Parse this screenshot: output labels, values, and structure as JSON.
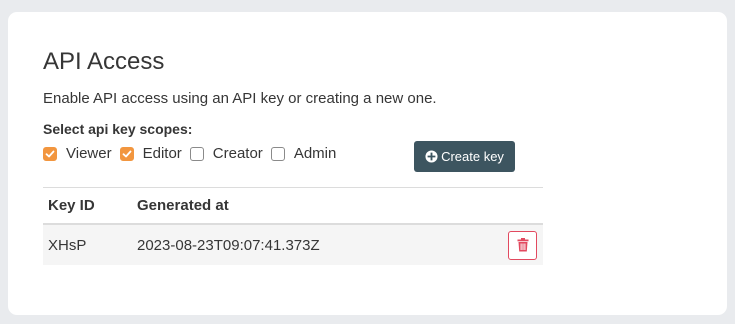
{
  "card": {
    "title": "API Access",
    "description": "Enable API access using an API key or creating a new one.",
    "scopes_label": "Select api key scopes:"
  },
  "scopes": [
    {
      "label": "Viewer",
      "checked": true
    },
    {
      "label": "Editor",
      "checked": true
    },
    {
      "label": "Creator",
      "checked": false
    },
    {
      "label": "Admin",
      "checked": false
    }
  ],
  "create_button": {
    "label": "Create key",
    "icon": "plus-circle-icon"
  },
  "table": {
    "headers": {
      "key_id": "Key ID",
      "generated_at": "Generated at"
    },
    "rows": [
      {
        "key_id": "XHsP",
        "generated_at": "2023-08-23T09:07:41.373Z"
      }
    ]
  },
  "colors": {
    "checkbox_checked": "#f2963f",
    "button_bg": "#3d5560",
    "delete_red": "#e2495f"
  }
}
